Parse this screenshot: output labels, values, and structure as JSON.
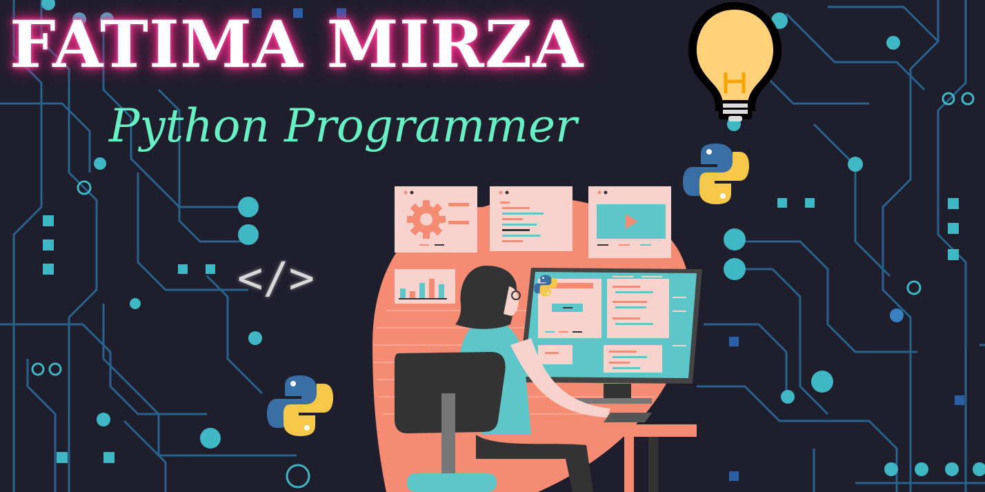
{
  "banner": {
    "title": "FATIMA MIRZA",
    "subtitle": "Python Programmer",
    "code_symbol": "</>"
  },
  "icons": [
    "lightbulb-icon",
    "python-logo-icon",
    "python-logo-icon",
    "gear-icon",
    "play-icon",
    "bar-chart-icon",
    "code-tag-icon"
  ],
  "colors": {
    "background": "#1f1e2c",
    "circuit": "#2a6a9a",
    "circuit_node": "#3fb7c4",
    "title_glow": "#ff2d8c",
    "subtitle": "#67f0c4",
    "accent_salmon": "#f48b72",
    "accent_teal": "#5cc6c9",
    "python_blue": "#3a6fa5",
    "python_yellow": "#f5c84a"
  }
}
